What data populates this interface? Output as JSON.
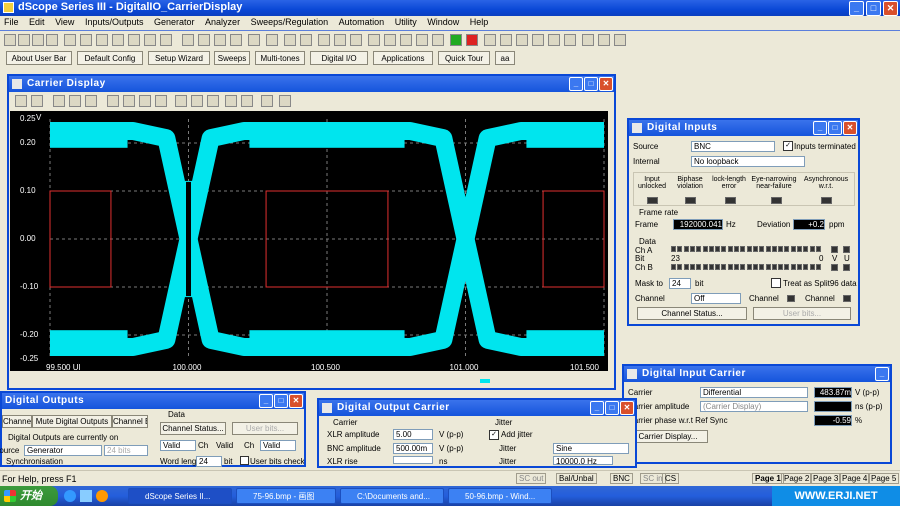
{
  "app": {
    "title": "dScope Series III - DigitalIO_CarrierDisplay"
  },
  "menu": [
    "File",
    "Edit",
    "View",
    "Inputs/Outputs",
    "Generator",
    "Analyzer",
    "Sweeps/Regulation",
    "Automation",
    "Utility",
    "Window",
    "Help"
  ],
  "quickbar": [
    "About User Bar",
    "Default Config",
    "Setup Wizard",
    "Sweeps",
    "Multi-tones",
    "Digital I/O",
    "Applications",
    "Quick Tour",
    "aa"
  ],
  "carrier_display": {
    "title": "Carrier Display",
    "y_unit": "V",
    "y_ticks": [
      "0.25",
      "0.20",
      "0.10",
      "0.00",
      "-0.10",
      "-0.20",
      "-0.25"
    ],
    "x_ticks": [
      "99.500 UI",
      "100.000",
      "100.500",
      "101.000",
      "101.500"
    ]
  },
  "chart_data": {
    "type": "line",
    "title": "",
    "xlabel": "",
    "ylabel": "V",
    "xlim": [
      99.5,
      101.5
    ],
    "ylim": [
      -0.25,
      0.25
    ],
    "grid": true,
    "series": [
      {
        "x": [
          99.5,
          99.8,
          99.92,
          100.0,
          100.08,
          100.2,
          100.5,
          100.8,
          100.92,
          101.0,
          101.08,
          101.2,
          101.5
        ],
        "y": [
          0.225,
          0.225,
          0.21,
          0.0,
          -0.21,
          -0.225,
          -0.225,
          -0.225,
          -0.21,
          0.0,
          0.21,
          0.225,
          0.225
        ]
      },
      {
        "x": [
          99.5,
          99.8,
          99.92,
          100.0,
          100.08,
          100.2,
          100.5,
          100.8,
          100.92,
          101.0,
          101.08,
          101.2,
          101.5
        ],
        "y": [
          -0.225,
          -0.225,
          -0.21,
          0.0,
          0.21,
          0.225,
          0.225,
          0.225,
          0.21,
          0.0,
          -0.21,
          -0.225,
          -0.225
        ]
      }
    ],
    "mask_levels": [
      0.1,
      -0.1
    ]
  },
  "digital_inputs": {
    "title": "Digital Inputs",
    "source_label": "Source",
    "source_value": "BNC",
    "inputs_terminated": "Inputs terminated",
    "internal_label": "Internal",
    "internal_value": "No loopback",
    "status": [
      "Input unlocked",
      "Biphase violation",
      "lock-length error",
      "Eye-narrowing near-failure",
      "Asynchronous w.r.t."
    ],
    "frame_rate_label": "Frame rate",
    "frame_label": "Frame",
    "frame_value": "192000.041",
    "frame_unit": "Hz",
    "deviation_label": "Deviation",
    "deviation_value": "+0.2",
    "deviation_unit": "ppm",
    "data_label": "Data",
    "cha_label": "Ch A",
    "bit_label": "Bit",
    "bit_hi": "23",
    "bit_lo": "0",
    "v_label": "V",
    "u_label": "U",
    "chb_label": "Ch B",
    "mask_label": "Mask to",
    "mask_value": "24",
    "mask_unit": "bit",
    "treat_split": "Treat as Split96 data",
    "channel_label": "Channel",
    "channel_value": "Off",
    "channel2": "Channel",
    "channel3": "Channel",
    "status_btn": "Channel Status...",
    "userbits_btn": "User bits..."
  },
  "digital_input_carrier": {
    "title": "Digital Input Carrier",
    "carrier_label": "Carrier",
    "carrier_value": "Differential",
    "carrier_reading": "483.87m",
    "carrier_unit": "V (p-p)",
    "amp_label": "Carrier amplitude",
    "amp_value": "(Carrier Display)",
    "amp_unit": "ns (p-p)",
    "phase_label": "Carrier phase w.r.t Ref Sync",
    "phase_value": "-0.59",
    "phase_unit": "%",
    "display_btn": "Carrier Display..."
  },
  "digital_outputs": {
    "title": "Digital Outputs",
    "btn1": "Channel A",
    "btn2": "Mute Digital Outputs",
    "btn3": "Channel B",
    "data_label": "Data",
    "status_btn": "Channel Status...",
    "userbits_btn": "User bits...",
    "notice": "Digital Outputs are currently on",
    "source_label": "Source",
    "source_value": "Generator",
    "bits_value": "24 bits",
    "sync_label": "Synchronisation",
    "valid1": "Valid",
    "ch1": "Ch",
    "valid2": "Valid",
    "ch2": "Ch",
    "valid3": "Valid",
    "wordlen_label": "Word length",
    "wordlen_value": "24",
    "wordlen_unit": "bit",
    "userbits_chk": "User bits check"
  },
  "digital_output_carrier": {
    "title": "Digital Output Carrier",
    "carrier_label": "Carrier",
    "xlr_label": "XLR amplitude",
    "xlr_value": "5.00",
    "xlr_unit": "V (p-p)",
    "bnc_label": "BNC amplitude",
    "bnc_value": "500.00m",
    "bnc_unit": "V (p-p)",
    "xlr_rise_label": "XLR rise",
    "xlr_rise_unit": "ns",
    "jitter_label": "Jitter",
    "add_jitter": "Add jitter",
    "jitter_type_label": "Jitter",
    "jitter_type_value": "Sine",
    "jitter_freq_label": "Jitter",
    "jitter_freq_value": "10000.0 Hz"
  },
  "statusbar": {
    "help": "For Help, press F1",
    "cells": [
      "SC out",
      "Bal/Unbal",
      "BNC",
      "SC in",
      "CS"
    ],
    "pages": [
      "Page 1",
      "Page 2",
      "Page 3",
      "Page 4",
      "Page 5"
    ]
  },
  "taskbar": {
    "start": "开始",
    "tasks": [
      "dScope Series II...",
      "75-96.bmp - 画图",
      "C:\\Documents and...",
      "50-96.bmp - Wind..."
    ],
    "tray": "WWW.ERJI.NET"
  },
  "colors": {
    "eye": "#00e5ee",
    "mask": "#e03030",
    "grid": "#7a7a7a",
    "titlebar": "#0a48d6"
  }
}
